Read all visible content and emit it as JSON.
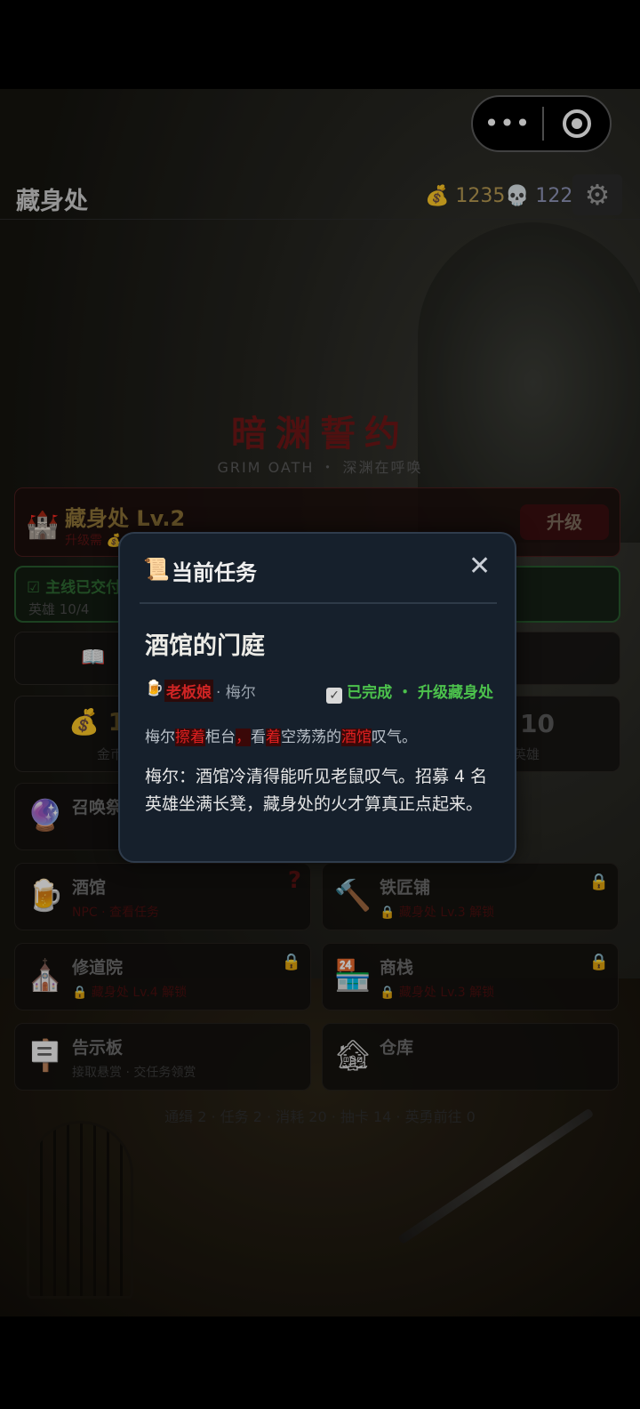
{
  "capsule": {
    "more": "•••"
  },
  "topbar": {
    "title": "藏身处",
    "gold": "1235",
    "souls": "122",
    "gold_icon": "money-bag-icon",
    "soul_icon": "skull-icon",
    "gear_icon": "gear-icon"
  },
  "logo": {
    "title": "暗渊誓约",
    "subtitle": "GRIM OATH ・ 深渊在呼唤"
  },
  "hideout": {
    "name": "藏身处 Lv.2",
    "upgrade_label": "升级"
  },
  "quest_bar": {
    "line1": "主线已交付",
    "line2": "英雄 10/4"
  },
  "stats": {
    "left_value": "12",
    "left_label": "金币",
    "right_value": "10",
    "right_label": "英雄"
  },
  "buildings": [
    {
      "name": "召唤祭坛",
      "sub": "",
      "icon": "crystal-ball-icon",
      "locked": false
    },
    {
      "name": "酒馆",
      "sub": "NPC · 查看任务",
      "icon": "beer-mug-icon",
      "locked": false,
      "has_quest": true
    },
    {
      "name": "铁匠铺",
      "sub": "藏身处 Lv.3 解锁",
      "icon": "hammer-icon",
      "locked": true
    },
    {
      "name": "修道院",
      "sub": "藏身处 Lv.4 解锁",
      "icon": "church-icon",
      "locked": true
    },
    {
      "name": "商栈",
      "sub": "藏身处 Lv.3 解锁",
      "icon": "shop-icon",
      "locked": true
    },
    {
      "name": "告示板",
      "sub": "接取悬赏 · 交任务领赏",
      "icon": "signpost-icon",
      "locked": false
    },
    {
      "name": "仓库",
      "sub": "",
      "icon": "warehouse-icon",
      "locked": false
    }
  ],
  "footer": "通缉 2 · 任务 2 · 消耗 20 · 抽卡 14 · 英勇前往 0",
  "modal": {
    "title": "当前任务",
    "scroll_icon": "scroll-icon",
    "close_icon": "close-icon",
    "quest_name": "酒馆的门庭",
    "npc_role": "老板娘",
    "npc_name": "· 梅尔",
    "status": "已完成 ・ 升级藏身处",
    "narration": [
      "梅尔",
      "擦着",
      "柜台",
      "，",
      "看",
      "着",
      "空荡荡的",
      "酒馆",
      "叹气。"
    ],
    "dialogue": "梅尔：酒馆冷清得能听见老鼠叹气。招募 4 名英雄坐满长凳，藏身处的火才算真正点起来。"
  }
}
